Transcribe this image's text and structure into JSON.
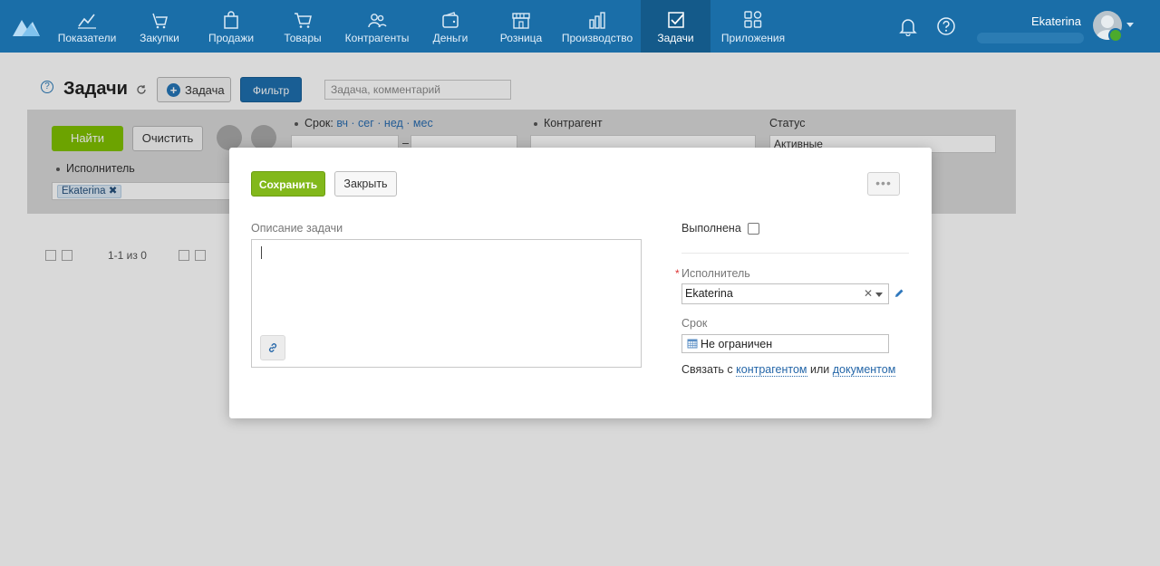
{
  "nav": {
    "items": [
      {
        "label": "Показатели",
        "icon": "chart-line-icon"
      },
      {
        "label": "Закупки",
        "icon": "purchases-icon"
      },
      {
        "label": "Продажи",
        "icon": "shopping-bag-icon"
      },
      {
        "label": "Товары",
        "icon": "cart-icon"
      },
      {
        "label": "Контрагенты",
        "icon": "people-icon"
      },
      {
        "label": "Деньги",
        "icon": "wallet-icon"
      },
      {
        "label": "Розница",
        "icon": "store-icon"
      },
      {
        "label": "Производство",
        "icon": "factory-icon"
      },
      {
        "label": "Задачи",
        "icon": "task-check-icon",
        "active": true
      },
      {
        "label": "Приложения",
        "icon": "apps-grid-icon"
      }
    ],
    "username": "Ekaterina"
  },
  "page": {
    "title": "Задачи",
    "add_task_label": "Задача",
    "filter_label": "Фильтр",
    "search_placeholder": "Задача, комментарий"
  },
  "filter": {
    "find_label": "Найти",
    "clear_label": "Очистить",
    "srok_label": "Срок:",
    "srok_links": "вч · сег · нед · мес",
    "kontragent_label": "Контрагент",
    "status_label": "Статус",
    "status_value": "Активные",
    "executor_label": "Исполнитель",
    "executor_chip": "Ekaterina ✖"
  },
  "pager": {
    "text": "1-1 из 0"
  },
  "modal": {
    "save_label": "Сохранить",
    "close_label": "Закрыть",
    "more_label": "•••",
    "description_label": "Описание задачи",
    "done_label": "Выполнена",
    "done_checked": false,
    "assignee_label": "Исполнитель",
    "assignee_value": "Ekaterina",
    "deadline_label": "Срок",
    "deadline_value": "Не ограничен",
    "link_prefix": "Связать с",
    "link_counterparty": "контрагентом",
    "link_or": "или",
    "link_document": "документом"
  },
  "colors": {
    "nav_bg": "#1a6ea8",
    "nav_active": "#145a8a",
    "primary_green": "#82b81b",
    "filter_blue": "#1e6fae",
    "link_blue": "#2466a8"
  }
}
